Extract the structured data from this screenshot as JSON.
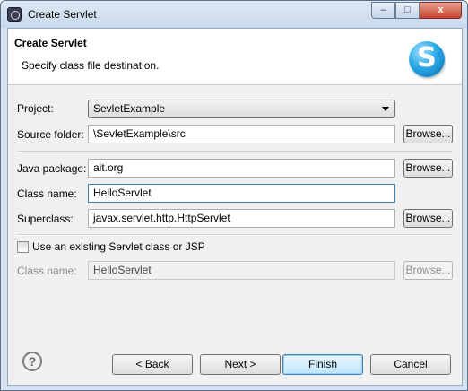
{
  "window": {
    "title": "Create Servlet",
    "controls": {
      "minimize": "–",
      "maximize": "□",
      "close": "x"
    }
  },
  "header": {
    "title": "Create Servlet",
    "description": "Specify class file destination.",
    "logo_letter": "S"
  },
  "form": {
    "project": {
      "label": "Project:",
      "value": "SevletExample"
    },
    "source_folder": {
      "label": "Source folder:",
      "value": "\\SevletExample\\src",
      "browse": "Browse..."
    },
    "java_package": {
      "label": "Java package:",
      "value": "ait.org",
      "browse": "Browse..."
    },
    "class_name": {
      "label": "Class name:",
      "value": "HelloServlet"
    },
    "superclass": {
      "label": "Superclass:",
      "value": "javax.servlet.http.HttpServlet",
      "browse": "Browse..."
    },
    "use_existing": {
      "label": "Use an existing Servlet class or JSP",
      "checked": false
    },
    "existing_class_name": {
      "label": "Class name:",
      "value": "HelloServlet",
      "browse": "Browse..."
    }
  },
  "buttons": {
    "help": "?",
    "back": "< Back",
    "next": "Next >",
    "finish": "Finish",
    "cancel": "Cancel"
  }
}
